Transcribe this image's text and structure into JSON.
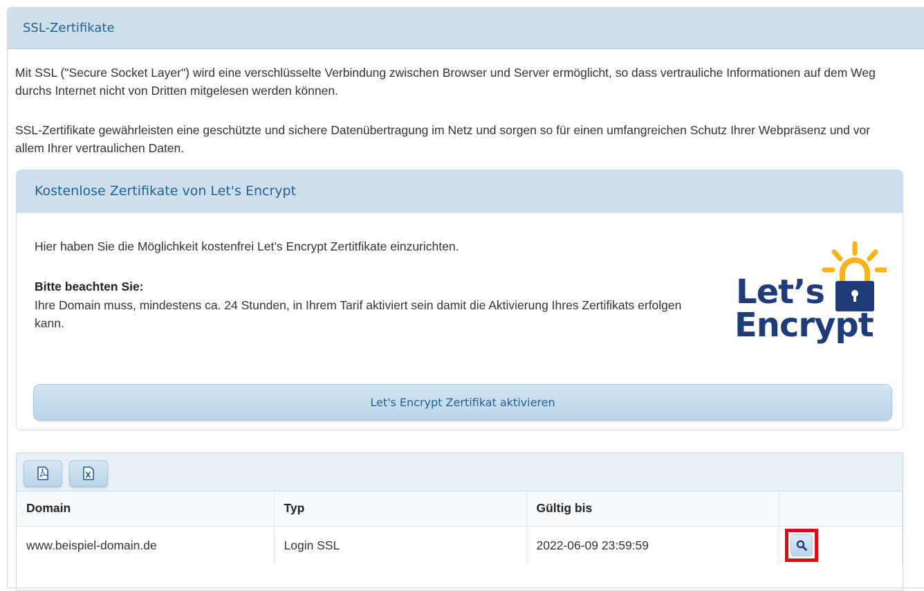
{
  "panel": {
    "title": "SSL-Zertifikate"
  },
  "intro": {
    "paragraph_1": "Mit SSL (\"Secure Socket Layer\") wird eine verschlüsselte Verbindung zwischen Browser und Server ermöglicht, so dass vertrauliche Informationen auf dem Weg durchs Internet nicht von Dritten mitgelesen werden können.",
    "paragraph_2": "SSL-Zertifikate gewährleisten eine geschützte und sichere Datenübertragung im Netz und sorgen so für einen umfangreichen Schutz Ihrer Webpräsenz und vor allem Ihrer vertraulichen Daten."
  },
  "letsencrypt": {
    "title": "Kostenlose Zertifikate von Let's Encrypt",
    "text": "Hier haben Sie die Möglichkeit kostenfrei Let’s Encrypt Zertitfikate einzurichten.",
    "note_head": "Bitte beachten Sie:",
    "note_body": "Ihre Domain muss, mindestens ca. 24 Stunden, in Ihrem Tarif aktiviert sein damit die Aktivierung Ihres Zertifikats erfolgen kann.",
    "logo_line_1": "Let’s",
    "logo_line_2": "Encrypt",
    "activate_label": "Let's Encrypt Zertifikat aktivieren"
  },
  "table": {
    "export_pdf_icon": "pdf-icon",
    "export_excel_icon": "excel-icon",
    "columns": [
      "Domain",
      "Typ",
      "Gültig bis",
      ""
    ],
    "rows": [
      {
        "domain": "www.beispiel-domain.de",
        "typ": "Login SSL",
        "gueltig_bis": "2022-06-09 23:59:59",
        "action_icon": "magnifier-icon"
      }
    ]
  },
  "colors": {
    "header_bg": "#cfe0ec",
    "title_blue": "#1f5f93",
    "logo_navy": "#1f3b78",
    "logo_yellow": "#f8b316",
    "highlight_red": "#e30613"
  }
}
